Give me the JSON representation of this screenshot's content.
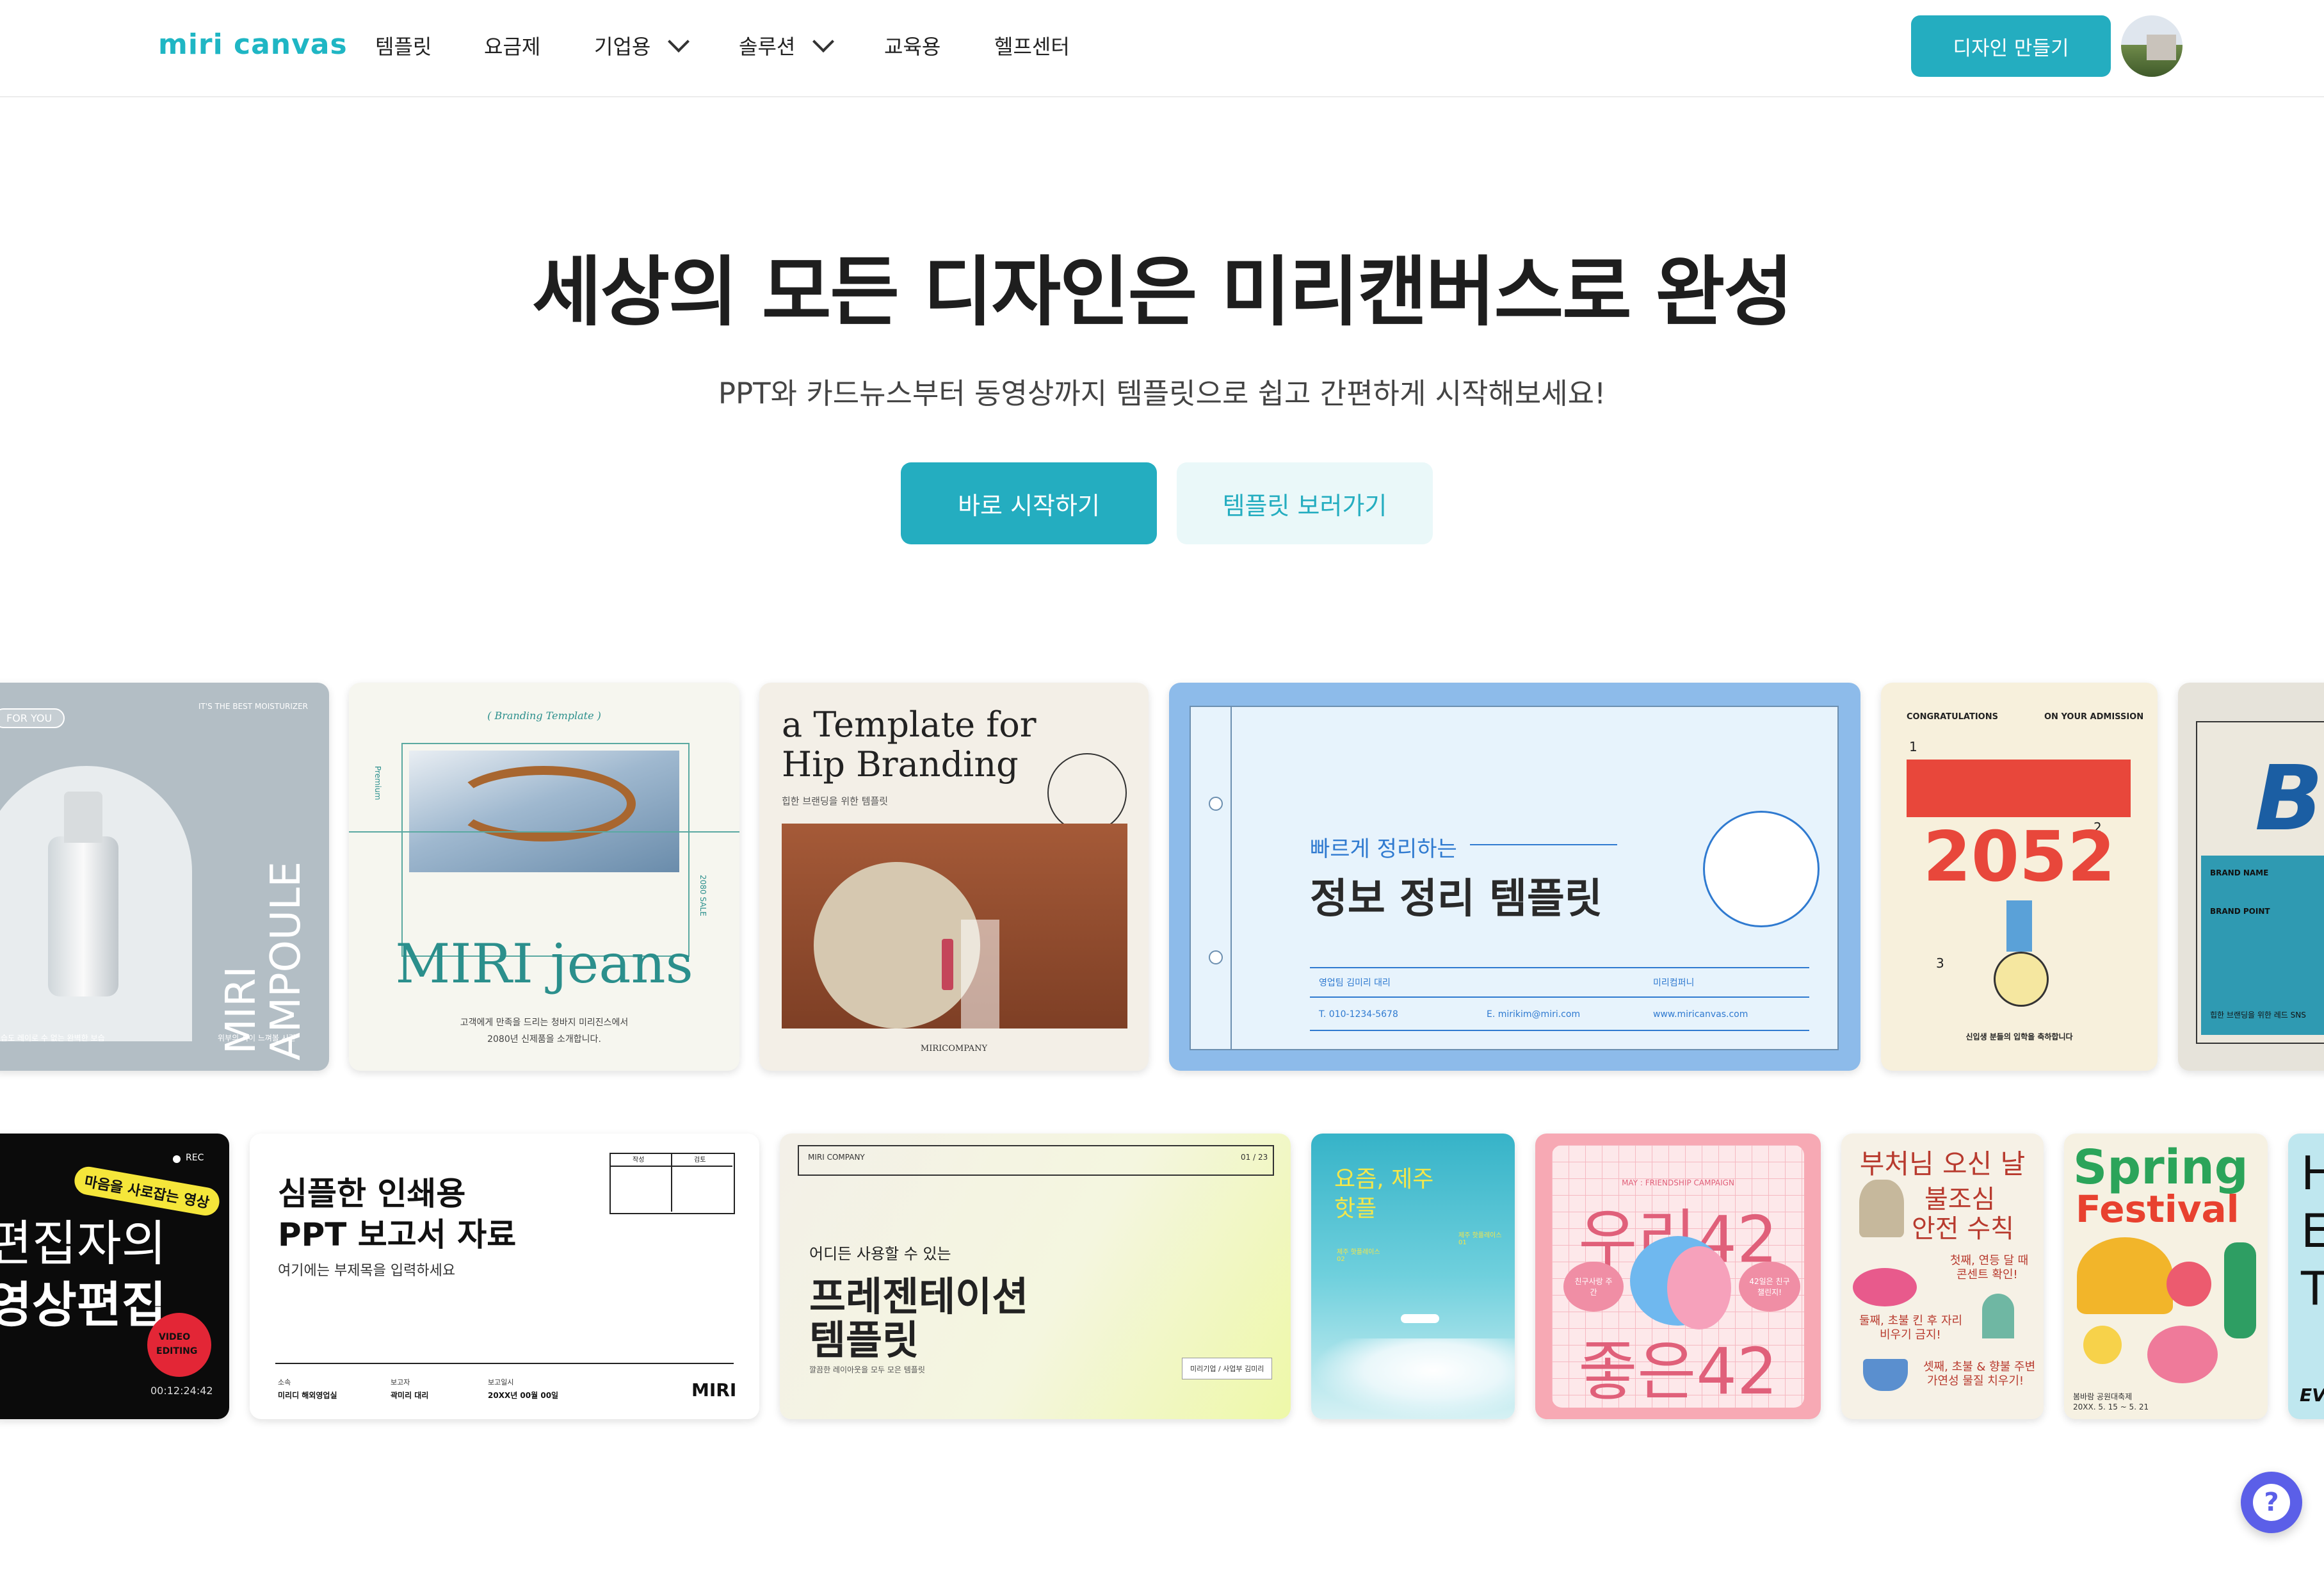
{
  "header": {
    "logo": "miri canvas",
    "nav": [
      {
        "label": "템플릿"
      },
      {
        "label": "요금제"
      },
      {
        "label": "기업용"
      },
      {
        "label": "솔루션"
      },
      {
        "label": "교육용"
      },
      {
        "label": "헬프센터"
      }
    ],
    "cta": "디자인 만들기"
  },
  "hero": {
    "title": "세상의 모든 디자인은 미리캔버스로 완성",
    "subtitle": "PPT와 카드뉴스부터 동영상까지 템플릿으로 쉽고 간편하게 시작해보세요!",
    "primary_button": "바로 시작하기",
    "secondary_button": "템플릿 보러가기"
  },
  "row1": {
    "ampoule": {
      "tag": "FOR YOU",
      "top_right": "IT'S THE BEST MOISTURIZER",
      "brand": "MIRI",
      "product": "AMPOULE",
      "foot_left": "보습도 레이로 수 없는 완벽한 보습",
      "foot_right": "위부의 직이 느껴볼 시간"
    },
    "jeans": {
      "tag": "( Branding Template )",
      "title": "MIRI jeans",
      "side_left": "Premium",
      "side_right": "2080 SALE",
      "desc1": "고객에게 만족을 드리는 청바지 미리진스에서",
      "desc2": "2080년 신제품을 소개합니다."
    },
    "hip": {
      "title1": "a Template for",
      "title2": "Hip Branding",
      "desc": "힙한 브랜딩을 위한 템플릿",
      "foot": "MIRICOMPANY"
    },
    "info": {
      "kicker": "빠르게 정리하는",
      "title": "정보 정리 템플릿",
      "c1": "영업팀 김미리 대리",
      "c2": "미리컴퍼니",
      "c3": "T. 010-1234-5678",
      "c4": "E. mirikim@miri.com",
      "c5": "www.miricanvas.com"
    },
    "admission": {
      "left": "CONGRATULATIONS",
      "right": "ON YOUR ADMISSION",
      "year": "2052",
      "n1": "1",
      "n2": "2",
      "n3": "3",
      "foot": "신입생 분들의 입학을 축하합니다"
    },
    "brand": {
      "title": "BR",
      "l1": "BRAND NAME",
      "l2": "BRAND POINT",
      "foot": "힙한 브랜딩을 위한 레드 SNS"
    }
  },
  "row2": {
    "video": {
      "rec": "REC",
      "sticker": "마음을 사로잡는 영상",
      "line1": "편집자의",
      "line2": "영상편집",
      "badge1": "VIDEO",
      "badge2": "EDITING",
      "time": "00:12:24:42"
    },
    "report": {
      "line1": "심플한 인쇄용",
      "line2": "PPT 보고서 자료",
      "desc": "여기에는 부제목을 입력하세요",
      "h1": "작성",
      "h2": "검토",
      "f1": "소속",
      "f1v": "미리디 해외영업실",
      "f2": "보고자",
      "f2v": "곽미리 대리",
      "f3": "보고일시",
      "f3v": "20XX년 00월 00일",
      "logo": "MIRI"
    },
    "present": {
      "company": "MIRI COMPANY",
      "page": "01 / 23",
      "kicker": "어디든 사용할 수 있는",
      "line1": "프레젠테이션",
      "line2": "템플릿",
      "desc": "깔끔한 레이아웃을 모두 모은 템플릿",
      "tag": "미리기업 / 사업부 김미리"
    },
    "jeju": {
      "line1": "요즘, 제주",
      "line2": "핫플",
      "label1": "제주 핫플레이스 01",
      "label2": "제주 핫플레이스 02"
    },
    "friend": {
      "campaign": "MAY : FRIENDSHIP CAMPAIGN",
      "top": "우리42",
      "bottom": "좋은42",
      "left": "친구사랑 주간",
      "right": "42일은 친구 챌린지!"
    },
    "buddha": {
      "title": "부처님 오신 날",
      "sub1": "불조심",
      "sub2": "안전 수칙",
      "t1": "첫째, 연등 달 때",
      "t2": "콘센트 확인!",
      "t3": "둘째, 초불 킨 후 자리",
      "t4": "비우기 금지!",
      "t5": "셋째, 초불 & 향불 주변",
      "t6": "가연성 물질 치우기!"
    },
    "spring": {
      "line1": "Spring",
      "line2": "Festival",
      "foot1": "봄바람 공원대축제",
      "foot2": "20XX. 5. 15 ~ 5. 21"
    },
    "partial": {
      "l1": "H",
      "l2": "E",
      "l3": "T",
      "foot": "EV"
    }
  },
  "help": {
    "icon": "question-icon"
  },
  "colors": {
    "accent": "#24adc0",
    "accent_light": "#eaf8f9",
    "help": "#5b5fe8"
  }
}
